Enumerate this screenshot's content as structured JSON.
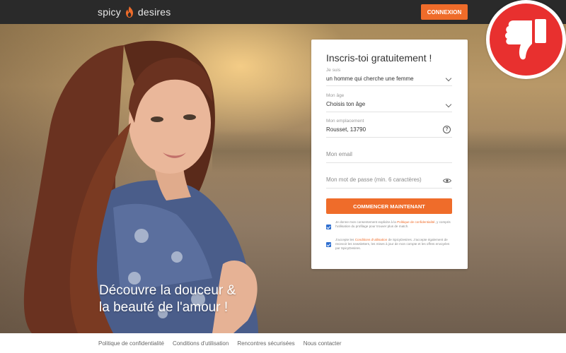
{
  "header": {
    "logo_left": "spicy",
    "logo_right": "desires",
    "login_label": "CONNEXION"
  },
  "hero": {
    "title_line1": "Découvre la douceur &",
    "title_line2": "la beauté de l'amour !"
  },
  "form": {
    "title": "Inscris-toi gratuitement !",
    "i_am": {
      "label": "Je suis",
      "value": "un homme qui cherche une femme"
    },
    "age": {
      "label": "Mon âge",
      "value": "Choisis ton âge"
    },
    "location": {
      "label": "Mon emplacement",
      "value": "Rousset, 13790"
    },
    "email": {
      "placeholder": "Mon email"
    },
    "password": {
      "placeholder": "Mon mot de passe (min. 6 caractères)"
    },
    "submit_label": "COMMENCER MAINTENANT",
    "consent1": {
      "text_before": "Je donne mon consentement explicite à la",
      "link": "Politique de confidentialité",
      "text_after": ", y compris l'utilisation du profilage pour trouver plus de match."
    },
    "consent2": {
      "text_before": "J'accepte les",
      "link": "Conditions d'utilisation",
      "text_after": "de SpicyDesires. J'accepte également de recevoir les newsletters, les mises à jour de mon compte et les offres envoyées par SpicyDesires."
    }
  },
  "footer": {
    "links": [
      "Politique de confidentialité",
      "Conditions d'utilisation",
      "Rencontres sécurisées",
      "Nous contacter"
    ]
  },
  "colors": {
    "accent": "#ef6c2a",
    "topbar": "#2a2a2a",
    "badge": "#e8302f"
  }
}
